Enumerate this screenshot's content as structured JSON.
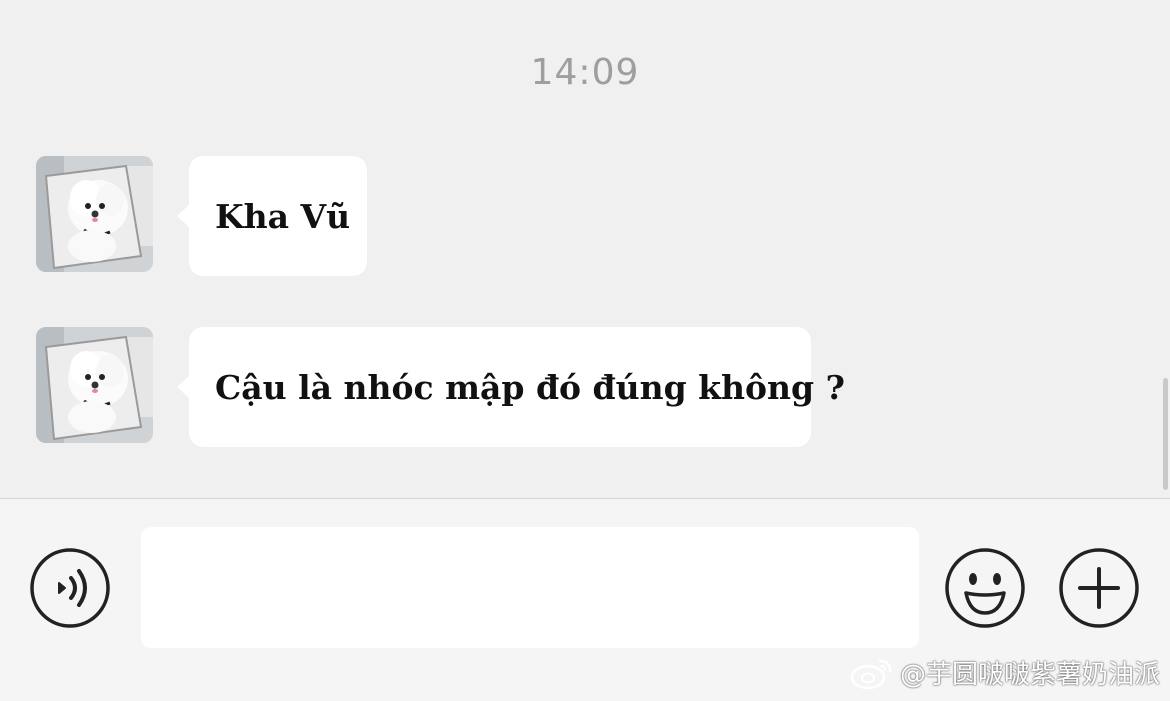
{
  "chat": {
    "timestamp": "14:09",
    "messages": [
      {
        "sender": "avatar-dog",
        "text": "Kha Vũ"
      },
      {
        "sender": "avatar-dog",
        "text": "Cậu là nhóc mập đó đúng không ?"
      }
    ]
  },
  "input_bar": {
    "voice_icon": "voice-icon",
    "message_value": "",
    "emoji_icon": "emoji-icon",
    "add_icon": "add-icon"
  },
  "watermark": {
    "logo": "weibo-logo",
    "text": "@芋圆啵啵紫薯奶油派"
  },
  "colors": {
    "background": "#f0f0f0",
    "bubble": "#ffffff",
    "timestamp": "#9e9e9e",
    "icon_stroke": "#222222"
  }
}
